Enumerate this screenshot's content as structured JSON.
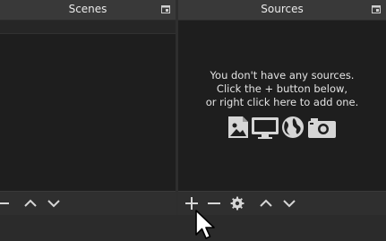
{
  "scenes_dock": {
    "title": "Scenes",
    "toolbar": {
      "remove_icon": "minus-icon",
      "move_up_icon": "chevron-up-icon",
      "move_down_icon": "chevron-down-icon"
    }
  },
  "sources_dock": {
    "title": "Sources",
    "empty_message": {
      "line1": "You don't have any sources.",
      "line2": "Click the + button below,",
      "line3": "or right click here to add one."
    },
    "empty_icons": [
      "image-icon",
      "monitor-icon",
      "globe-icon",
      "camera-icon"
    ],
    "toolbar": {
      "add_icon": "plus-icon",
      "remove_icon": "minus-icon",
      "properties_icon": "gear-icon",
      "move_up_icon": "chevron-up-icon",
      "move_down_icon": "chevron-down-icon"
    }
  },
  "colors": {
    "dock_background": "#1f1f1f",
    "titlebar": "#393939",
    "toolbar": "#2f2f2f",
    "icon": "#d6d6d6"
  }
}
